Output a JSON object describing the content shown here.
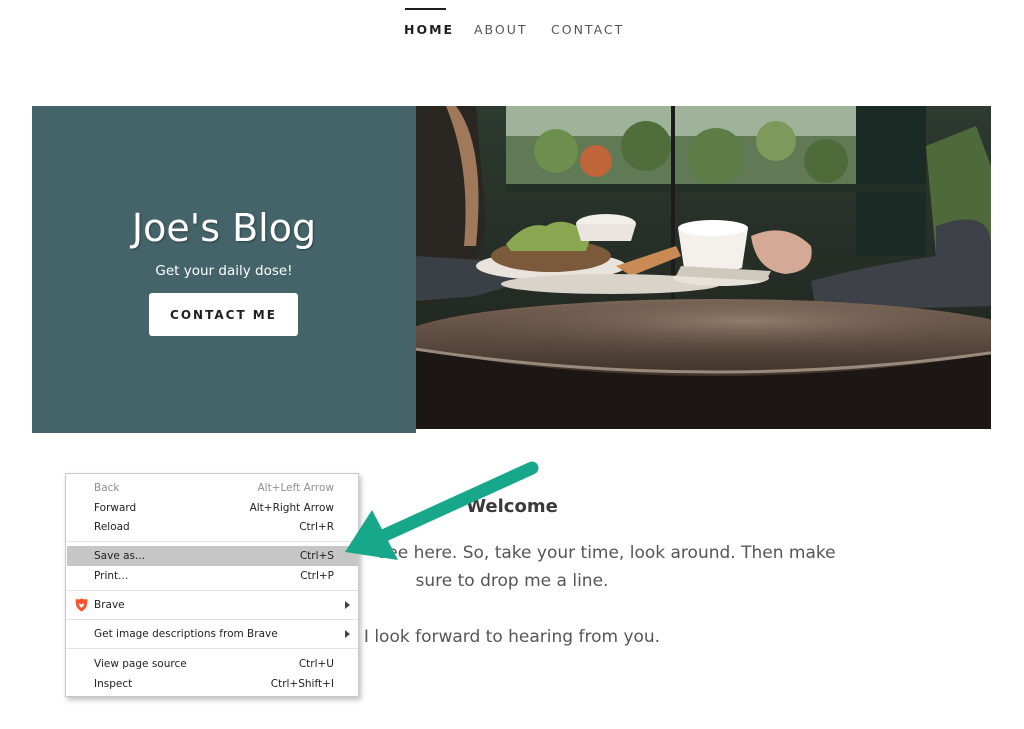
{
  "nav": {
    "items": [
      {
        "label": "HOME",
        "active": true
      },
      {
        "label": "ABOUT",
        "active": false
      },
      {
        "label": "CONTACT",
        "active": false
      }
    ]
  },
  "hero": {
    "title": "Joe's Blog",
    "subtitle": "Get your daily dose!",
    "button_label": "CONTACT ME",
    "panel_color": "#456469"
  },
  "welcome": {
    "heading": "Welcome",
    "line1": "see here. So, take your time, look around. Then make",
    "line2": "sure to drop me a line.",
    "line3": "I look forward to hearing from you."
  },
  "context_menu": {
    "items": [
      {
        "label": "Back",
        "shortcut": "Alt+Left Arrow",
        "disabled": true
      },
      {
        "label": "Forward",
        "shortcut": "Alt+Right Arrow"
      },
      {
        "label": "Reload",
        "shortcut": "Ctrl+R"
      },
      {
        "label": "Save as...",
        "shortcut": "Ctrl+S",
        "highlighted": true
      },
      {
        "label": "Print...",
        "shortcut": "Ctrl+P"
      },
      {
        "label": "Brave",
        "submenu": true,
        "icon": "brave-lion-icon"
      },
      {
        "label": "Get image descriptions from Brave",
        "submenu": true
      },
      {
        "label": "View page source",
        "shortcut": "Ctrl+U"
      },
      {
        "label": "Inspect",
        "shortcut": "Ctrl+Shift+I"
      }
    ]
  },
  "annotation": {
    "arrow_color": "#17a88b",
    "points_to": "Save as..."
  }
}
